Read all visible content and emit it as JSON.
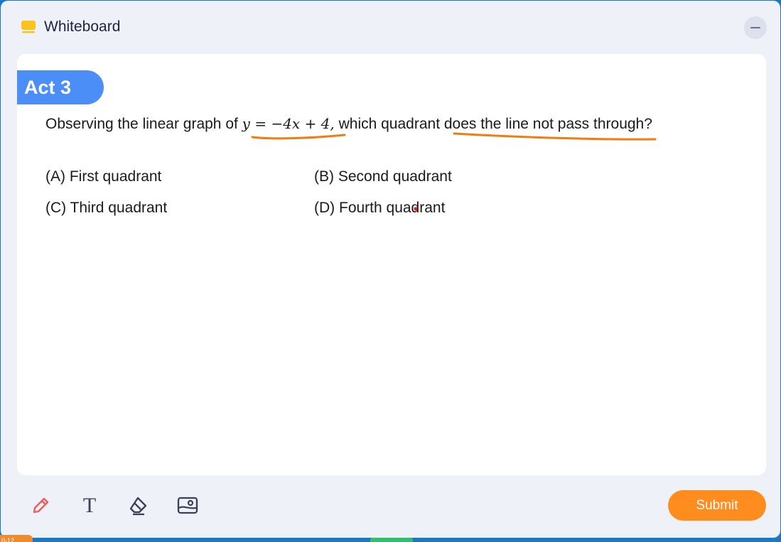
{
  "app": {
    "title": "Whiteboard",
    "icon": "whiteboard-icon",
    "accent": "#ffc21a"
  },
  "activity": {
    "badge": "Act 3",
    "badge_color": "#4c8ef7"
  },
  "question": {
    "prefix": "Observing the linear graph of ",
    "equation": "y = −4x + 4,",
    "suffix": " which quadrant does the line not pass through?",
    "highlight_color": "#f07c12"
  },
  "options": {
    "a": "(A) First quadrant",
    "b": "(B) Second quadrant",
    "c": "(C) Third quadrant",
    "d": "(D) Fourth quadrant"
  },
  "toolbar": {
    "tools": [
      "pencil-icon",
      "text-icon",
      "eraser-icon",
      "image-icon"
    ],
    "text_tool_glyph": "T",
    "submit_label": "Submit",
    "submit_color": "#ff8c1f"
  },
  "taskbar": {
    "tag_text": "0-12"
  }
}
